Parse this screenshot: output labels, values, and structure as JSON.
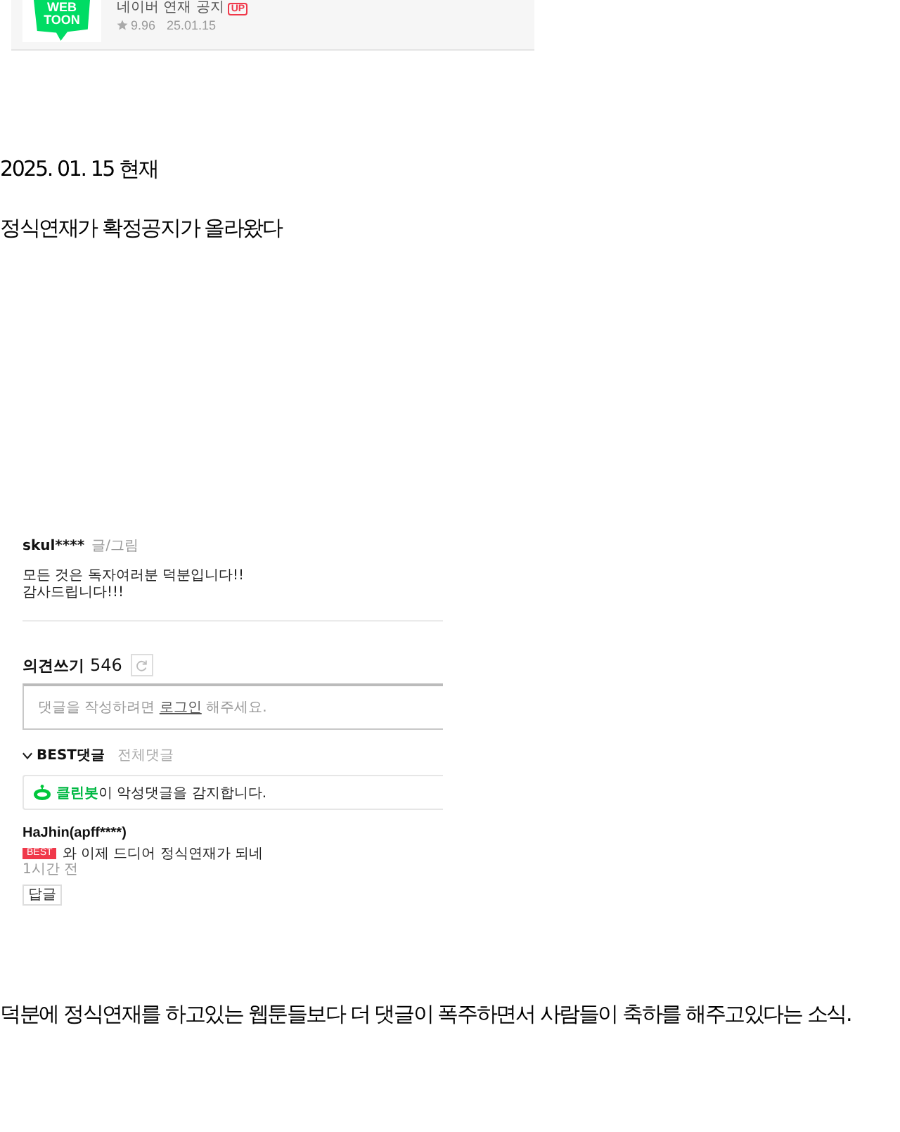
{
  "webtoon_card": {
    "logo_text": [
      "WEB",
      "TOON"
    ],
    "title": "네이버 연재 공지",
    "badge": "UP",
    "rating": "9.96",
    "date": "25.01.15"
  },
  "date_line": "2025. 01. 15 현재",
  "intro": "정식연재가 확정공지가 올라왔다",
  "comment_screenshot": {
    "author": {
      "name": "skul****",
      "role": "글/그림"
    },
    "author_note": [
      "모든 것은 독자여러분 덕분입니다!!",
      "감사드립니다!!!"
    ],
    "comments_heading": {
      "label": "의견쓰기",
      "count": "546"
    },
    "comment_input": {
      "prompt_before": "댓글을 작성하려면",
      "login_link": "로그인",
      "prompt_after": "해주세요."
    },
    "tabs": [
      {
        "label": "BEST댓글",
        "selected": true
      },
      {
        "label": "전체댓글",
        "selected": false
      }
    ],
    "cleanbot_notice": {
      "highlight": "클린봇",
      "text": "이 악성댓글을 감지합니다."
    },
    "comments": [
      {
        "author": "HaJhin(apff****)",
        "badge": "BEST",
        "text": "와 이제 드디어 정식연재가 되네",
        "time": "1시간 전",
        "reply_button": "답글"
      }
    ]
  },
  "closing": "덕분에 정식연재를 하고있는 웹툰들보다 더 댓글이 폭주하면서 사람들이 축하를 해주고있다는 소식."
}
